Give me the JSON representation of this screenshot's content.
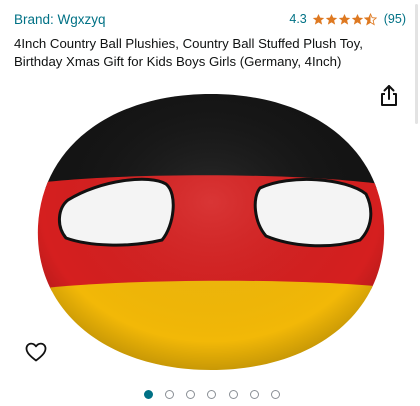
{
  "brand": {
    "label": "Brand: Wgxzyq"
  },
  "rating": {
    "value": "4.3",
    "stars": 4.5,
    "count": "(95)"
  },
  "product": {
    "title": "4Inch Country Ball Plushies, Country Ball Stuffed Plush Toy, Birthday Xmas Gift for Kids Boys Girls (Germany, 4Inch)"
  },
  "icons": {
    "share": "share-icon",
    "wishlist": "heart-icon"
  },
  "carousel": {
    "total": 7,
    "active": 0
  },
  "colors": {
    "link": "#007185",
    "star": "#de7921",
    "flag_black": "#141414",
    "flag_red": "#d51f1f",
    "flag_gold": "#f2b807"
  }
}
